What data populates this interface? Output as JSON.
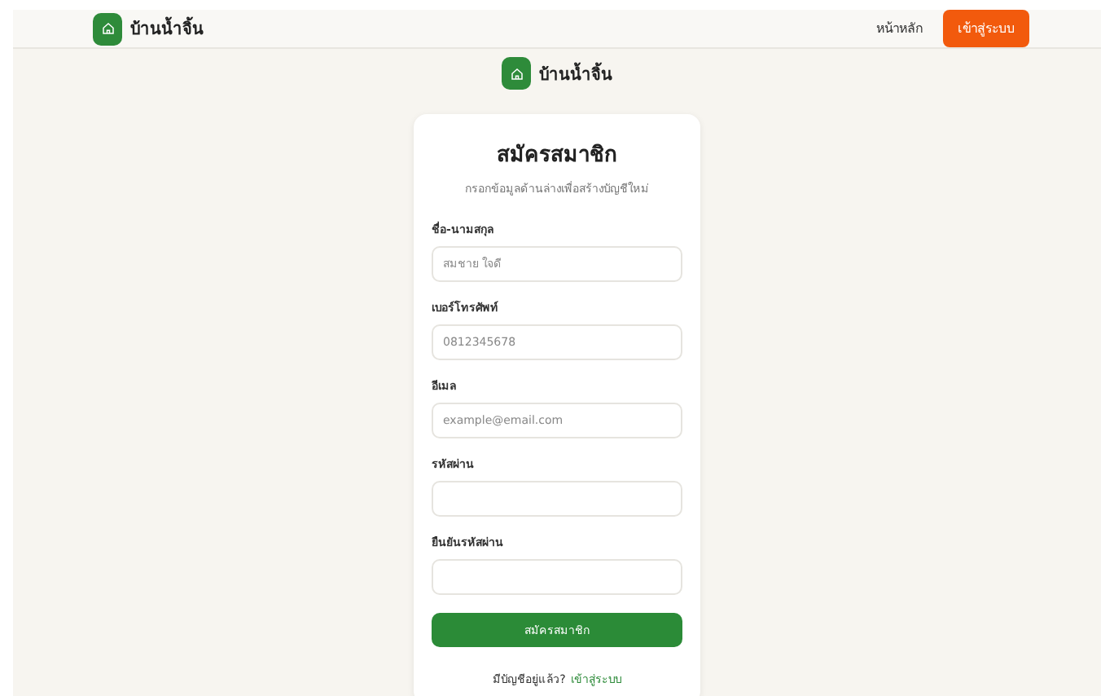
{
  "header": {
    "brand": "บ้านน้ำจิ้น",
    "nav_link": "หน้าหลัก",
    "login_button": "เข้าสู่ระบบ"
  },
  "brand_title": "บ้านน้ำจิ้น",
  "form": {
    "title": "สมัครสมาชิก",
    "subtitle": "กรอกข้อมูลด้านล่างเพื่อสร้างบัญชีใหม่",
    "fields": [
      {
        "label": "ชื่อ-นามสกุล",
        "placeholder": "สมชาย ใจดี"
      },
      {
        "label": "เบอร์โทรศัพท์",
        "placeholder": "0812345678"
      },
      {
        "label": "อีเมล",
        "placeholder": "example@email.com"
      },
      {
        "label": "รหัสผ่าน"
      },
      {
        "label": "ยืนยันรหัสผ่าน"
      }
    ],
    "submit": "สมัครสมาชิก",
    "footer_text": "มีบัญชีอยู่แล้ว?",
    "footer_link": "เข้าสู่ระบบ"
  }
}
